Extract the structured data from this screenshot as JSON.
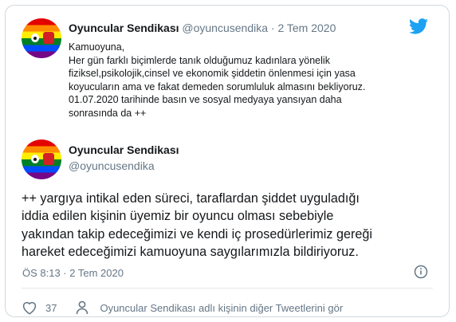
{
  "quoted_tweet": {
    "author_name": "Oyuncular Sendikası",
    "author_handle": "@oyuncusendika",
    "separator": "·",
    "date": "2 Tem 2020",
    "lines": [
      "Kamuoyuna,",
      "Her gün farklı biçimlerde tanık olduğumuz kadınlara yönelik",
      "fiziksel,psikolojik,cinsel ve ekonomik şiddetin önlenmesi için yasa",
      "koyucuların ama ve fakat demeden sorumluluk almasını bekliyoruz.",
      "01.07.2020 tarihinde basın ve sosyal medyaya yansıyan daha",
      "sonrasında da ++"
    ]
  },
  "tweet": {
    "author_name": "Oyuncular Sendikası",
    "author_handle": "@oyuncusendika",
    "lines": [
      "++ yargıya intikal eden süreci, taraflardan şiddet uyguladığı",
      "iddia edilen kişinin üyemiz bir oyuncu  olması sebebiyle",
      "yakından takip edeceğimizi ve kendi iç prosedürlerimiz gereği",
      "hareket edeceğimizi kamuoyuna saygılarımızla bildiriyoruz."
    ],
    "timestamp": "ÖS 8:13 · 2 Tem 2020",
    "like_count": "37",
    "see_more_text": "Oyuncular Sendikası adlı kişinin diğer Tweetlerini gör"
  },
  "icons": {
    "brand": "twitter-bird-icon",
    "info": "info-icon",
    "like": "heart-icon",
    "profile": "person-icon"
  },
  "colors": {
    "brand": "#1da1f2",
    "muted": "#657786",
    "border": "#cfd9de"
  }
}
